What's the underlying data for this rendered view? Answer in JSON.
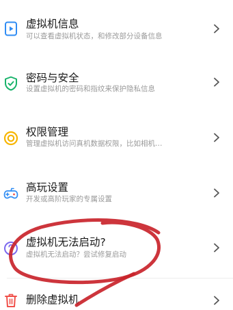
{
  "settings": {
    "items": [
      {
        "title": "虚拟机信息",
        "subtitle": "可以查看虚拟机状态，和修改部分设备信息",
        "icon": "vm-info-icon"
      },
      {
        "title": "密码与安全",
        "subtitle": "设置虚拟机的密码和指纹来保护隐私信息",
        "icon": "shield-check-icon"
      },
      {
        "title": "权限管理",
        "subtitle": "管理虚拟机访问真机数据权限，比如相机…",
        "icon": "permission-ring-icon"
      },
      {
        "title": "高玩设置",
        "subtitle": "开发或高阶玩家的专属设置",
        "icon": "gamepad-icon"
      },
      {
        "title": "虚拟机无法启动?",
        "subtitle": "虚拟机无法启动？尝试修复启动",
        "icon": "help-icon"
      },
      {
        "title": "删除虚拟机",
        "subtitle": "",
        "icon": "trash-icon"
      }
    ]
  },
  "colors": {
    "icon_blue": "#2f8cf4",
    "icon_green": "#19b36b",
    "icon_yellow": "#f7b500",
    "icon_help": "#7b68ee",
    "icon_red": "#f0504a",
    "annotation_red": "#c9242b",
    "chevron": "#555555"
  }
}
